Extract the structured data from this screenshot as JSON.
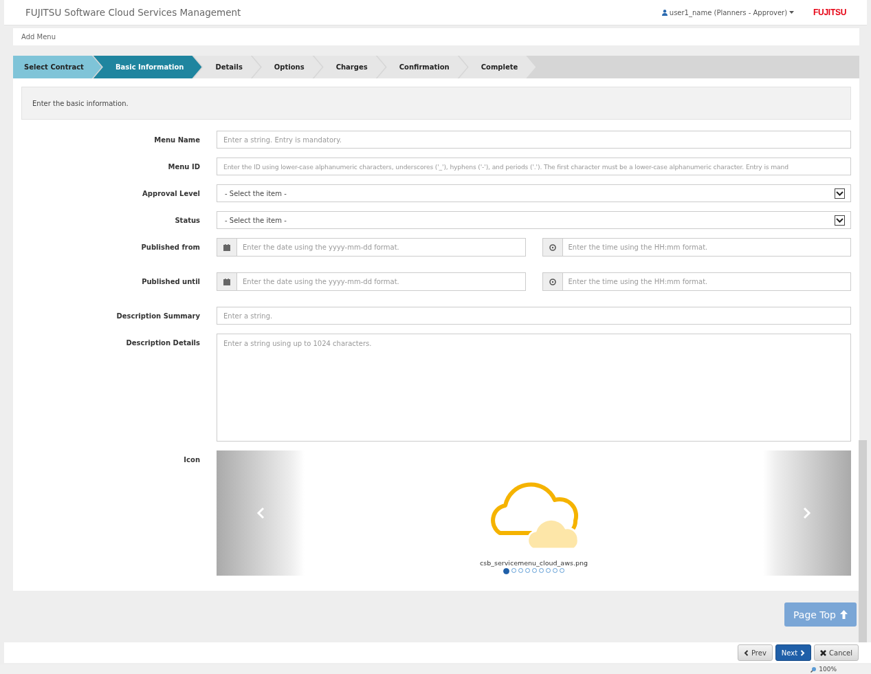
{
  "header": {
    "title": "FUJITSU Software Cloud Services Management",
    "user": "user1_name (Planners - Approver)",
    "logo": "FUJITSU"
  },
  "breadcrumb": "Add Menu",
  "steps": [
    {
      "label": "Select Contract",
      "completed": true,
      "selected": false
    },
    {
      "label": "Basic Information",
      "completed": false,
      "selected": true
    },
    {
      "label": "Details",
      "completed": false,
      "selected": false
    },
    {
      "label": "Options",
      "completed": false,
      "selected": false
    },
    {
      "label": "Charges",
      "completed": false,
      "selected": false
    },
    {
      "label": "Confirmation",
      "completed": false,
      "selected": false
    },
    {
      "label": "Complete",
      "completed": false,
      "selected": false
    }
  ],
  "instruction": "Enter the basic information.",
  "fields": [
    {
      "kind": "text",
      "label": "Menu Name",
      "placeholder": "Enter a string. Entry is mandatory."
    },
    {
      "kind": "text",
      "label": "Menu ID",
      "placeholder": "Enter the ID using lower-case alphanumeric characters, underscores ('_'), hyphens ('-'), and periods ('.'). The first character must be a lower-case alphanumeric character. Entry is mand"
    },
    {
      "kind": "select",
      "label": "Approval Level",
      "value": "- Select the item -"
    },
    {
      "kind": "select",
      "label": "Status",
      "value": "- Select the item -"
    },
    {
      "kind": "datetime",
      "label": "Published from",
      "date_placeholder": "Enter the date using the yyyy-mm-dd format.",
      "time_placeholder": "Enter the time using the HH:mm format."
    },
    {
      "kind": "datetime",
      "label": "Published until",
      "date_placeholder": "Enter the date using the yyyy-mm-dd format.",
      "time_placeholder": "Enter the time using the HH:mm format."
    },
    {
      "kind": "text",
      "label": "Description Summary",
      "placeholder": "Enter a string."
    },
    {
      "kind": "textarea",
      "label": "Description Details",
      "placeholder": "Enter a string using up to 1024 characters."
    },
    {
      "kind": "icon",
      "label": "Icon",
      "filename": "csb_servicemenu_cloud_aws.png",
      "dots": [
        {
          "selected": true
        },
        {
          "selected": false
        },
        {
          "selected": false
        },
        {
          "selected": false
        },
        {
          "selected": false
        },
        {
          "selected": false
        },
        {
          "selected": false
        },
        {
          "selected": false
        },
        {
          "selected": false
        }
      ]
    }
  ],
  "page_top": "Page Top",
  "buttons": [
    {
      "kind": "prev",
      "label": "Prev"
    },
    {
      "kind": "next",
      "label": "Next"
    },
    {
      "kind": "cancel",
      "label": "Cancel"
    }
  ],
  "zoom": "100%"
}
